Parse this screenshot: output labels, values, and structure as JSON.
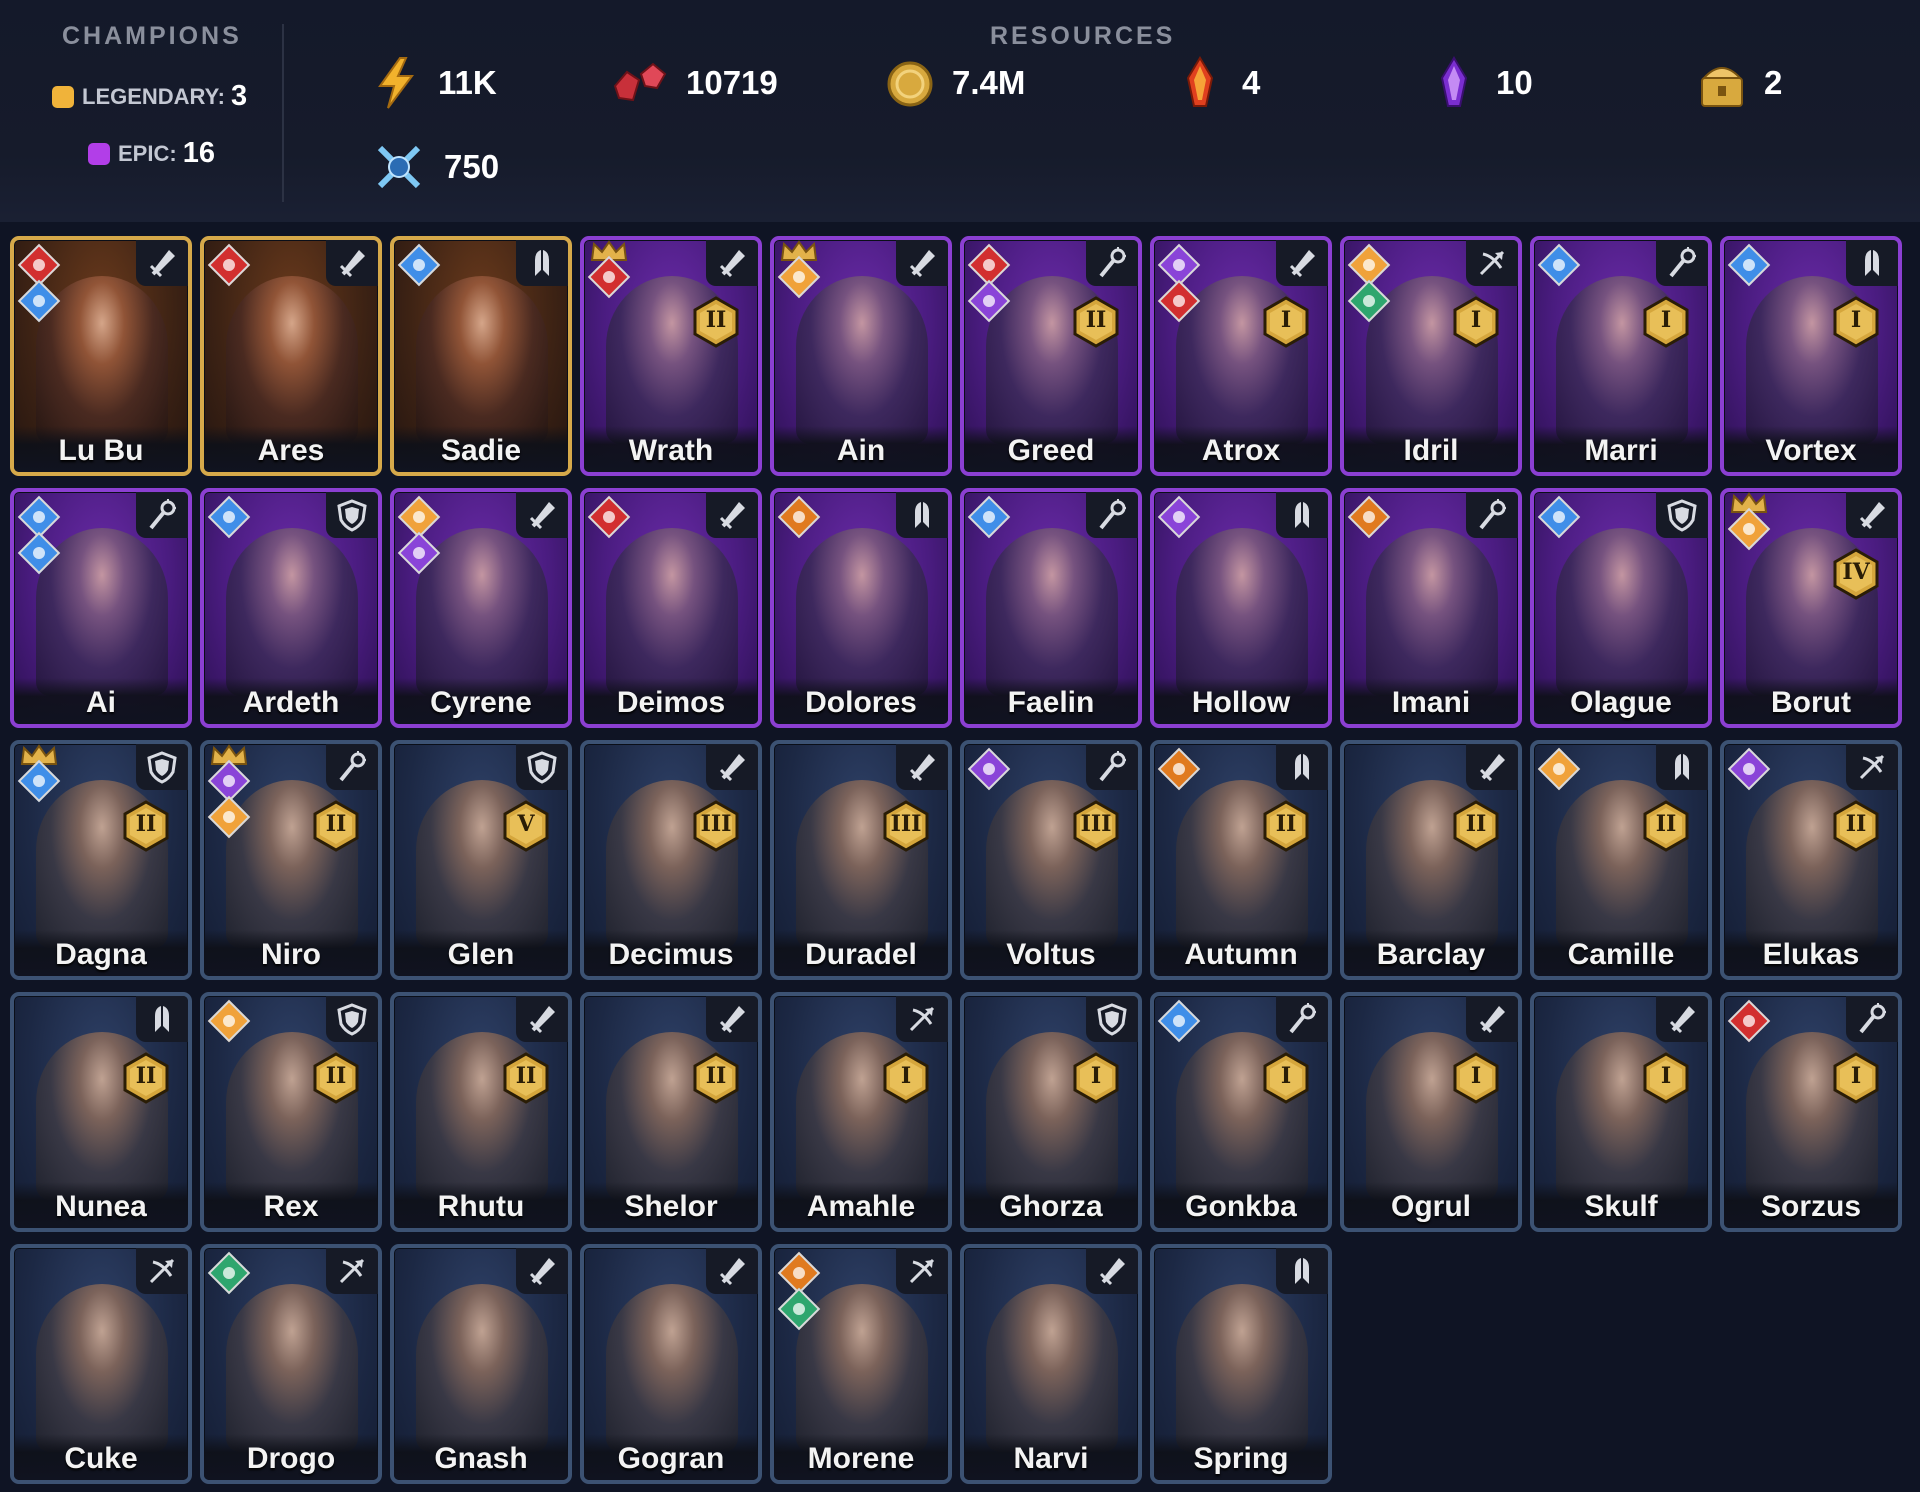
{
  "header": {
    "champions_title": "CHAMPIONS",
    "resources_title": "RESOURCES",
    "legendary": {
      "label": "LEGENDARY:",
      "count": "3",
      "color": "#f0b33a"
    },
    "epic": {
      "label": "EPIC:",
      "count": "16",
      "color": "#b23ee8"
    },
    "resources": [
      {
        "icon": "energy-icon",
        "value": "11K"
      },
      {
        "icon": "rubies-icon",
        "value": "10719"
      },
      {
        "icon": "gold-coin-icon",
        "value": "7.4M"
      },
      {
        "icon": "fire-shard-icon",
        "value": "4"
      },
      {
        "icon": "void-shard-icon",
        "value": "10"
      },
      {
        "icon": "chest-icon",
        "value": "2"
      },
      {
        "icon": "arena-token-icon",
        "value": "750"
      }
    ]
  },
  "colors": {
    "legendary_border": "#d6a94a",
    "epic_border": "#8b3fd2",
    "rare_border": "#3c5273",
    "affinity_order": "#3f8ee8",
    "affinity_chaos": "#d22f2f",
    "affinity_spirit": "#8a44d8",
    "affinity_fire": "#e07a1f",
    "affinity_orb": "#f0a23a",
    "affinity_nature": "#2ea66e"
  },
  "champions": [
    {
      "name": "Lu Bu",
      "rarity": "legendary",
      "role": "sword",
      "affinities": [
        "chaos",
        "order"
      ]
    },
    {
      "name": "Ares",
      "rarity": "legendary",
      "role": "sword",
      "affinities": [
        "chaos"
      ]
    },
    {
      "name": "Sadie",
      "rarity": "legendary",
      "role": "support",
      "affinities": [
        "order"
      ]
    },
    {
      "name": "Wrath",
      "rarity": "epic",
      "role": "sword",
      "affinities": [
        "chaos"
      ],
      "crown": true,
      "rank": "II"
    },
    {
      "name": "Ain",
      "rarity": "epic",
      "role": "sword",
      "affinities": [
        "orb"
      ],
      "crown": true
    },
    {
      "name": "Greed",
      "rarity": "epic",
      "role": "mage",
      "affinities": [
        "chaos",
        "spirit"
      ],
      "rank": "II"
    },
    {
      "name": "Atrox",
      "rarity": "epic",
      "role": "sword",
      "affinities": [
        "spirit",
        "chaos"
      ],
      "rank": "I"
    },
    {
      "name": "Idril",
      "rarity": "epic",
      "role": "ranged",
      "affinities": [
        "orb",
        "nature"
      ],
      "rank": "I"
    },
    {
      "name": "Marri",
      "rarity": "epic",
      "role": "mage",
      "affinities": [
        "order"
      ],
      "rank": "I"
    },
    {
      "name": "Vortex",
      "rarity": "epic",
      "role": "support",
      "affinities": [
        "order"
      ],
      "rank": "I"
    },
    {
      "name": "Ai",
      "rarity": "epic",
      "role": "mage",
      "affinities": [
        "order",
        "order"
      ]
    },
    {
      "name": "Ardeth",
      "rarity": "epic",
      "role": "shield",
      "affinities": [
        "order"
      ]
    },
    {
      "name": "Cyrene",
      "rarity": "epic",
      "role": "sword",
      "affinities": [
        "orb",
        "spirit"
      ]
    },
    {
      "name": "Deimos",
      "rarity": "epic",
      "role": "sword",
      "affinities": [
        "chaos"
      ]
    },
    {
      "name": "Dolores",
      "rarity": "epic",
      "role": "support",
      "affinities": [
        "fire"
      ]
    },
    {
      "name": "Faelin",
      "rarity": "epic",
      "role": "mage",
      "affinities": [
        "order"
      ]
    },
    {
      "name": "Hollow",
      "rarity": "epic",
      "role": "support",
      "affinities": [
        "spirit"
      ]
    },
    {
      "name": "Imani",
      "rarity": "epic",
      "role": "mage",
      "affinities": [
        "fire"
      ]
    },
    {
      "name": "Olague",
      "rarity": "epic",
      "role": "shield",
      "affinities": [
        "order"
      ]
    },
    {
      "name": "Borut",
      "rarity": "epic",
      "role": "sword",
      "affinities": [
        "orb"
      ],
      "crown": true,
      "rank": "IV"
    },
    {
      "name": "Dagna",
      "rarity": "rare",
      "role": "shield",
      "affinities": [
        "order"
      ],
      "crown": true,
      "rank": "II"
    },
    {
      "name": "Niro",
      "rarity": "rare",
      "role": "mage",
      "affinities": [
        "spirit",
        "orb"
      ],
      "crown": true,
      "rank": "II"
    },
    {
      "name": "Glen",
      "rarity": "rare",
      "role": "shield",
      "affinities": [],
      "rank": "V"
    },
    {
      "name": "Decimus",
      "rarity": "rare",
      "role": "sword",
      "affinities": [],
      "rank": "III"
    },
    {
      "name": "Duradel",
      "rarity": "rare",
      "role": "sword",
      "affinities": [],
      "rank": "III"
    },
    {
      "name": "Voltus",
      "rarity": "rare",
      "role": "mage",
      "affinities": [
        "spirit"
      ],
      "rank": "III"
    },
    {
      "name": "Autumn",
      "rarity": "rare",
      "role": "support",
      "affinities": [
        "fire"
      ],
      "rank": "II"
    },
    {
      "name": "Barclay",
      "rarity": "rare",
      "role": "sword",
      "affinities": [],
      "rank": "II"
    },
    {
      "name": "Camille",
      "rarity": "rare",
      "role": "support",
      "affinities": [
        "orb"
      ],
      "rank": "II"
    },
    {
      "name": "Elukas",
      "rarity": "rare",
      "role": "ranged",
      "affinities": [
        "spirit"
      ],
      "rank": "II"
    },
    {
      "name": "Nunea",
      "rarity": "rare",
      "role": "support",
      "affinities": [],
      "rank": "II"
    },
    {
      "name": "Rex",
      "rarity": "rare",
      "role": "shield",
      "affinities": [
        "orb"
      ],
      "rank": "II"
    },
    {
      "name": "Rhutu",
      "rarity": "rare",
      "role": "sword",
      "affinities": [],
      "rank": "II"
    },
    {
      "name": "Shelor",
      "rarity": "rare",
      "role": "sword",
      "affinities": [],
      "rank": "II"
    },
    {
      "name": "Amahle",
      "rarity": "rare",
      "role": "ranged",
      "affinities": [],
      "rank": "I"
    },
    {
      "name": "Ghorza",
      "rarity": "rare",
      "role": "shield",
      "affinities": [],
      "rank": "I"
    },
    {
      "name": "Gonkba",
      "rarity": "rare",
      "role": "mage",
      "affinities": [
        "order"
      ],
      "rank": "I"
    },
    {
      "name": "Ogrul",
      "rarity": "rare",
      "role": "sword",
      "affinities": [],
      "rank": "I"
    },
    {
      "name": "Skulf",
      "rarity": "rare",
      "role": "sword",
      "affinities": [],
      "rank": "I"
    },
    {
      "name": "Sorzus",
      "rarity": "rare",
      "role": "mage",
      "affinities": [
        "chaos"
      ],
      "rank": "I"
    },
    {
      "name": "Cuke",
      "rarity": "rare",
      "role": "ranged",
      "affinities": []
    },
    {
      "name": "Drogo",
      "rarity": "rare",
      "role": "ranged",
      "affinities": [
        "nature"
      ]
    },
    {
      "name": "Gnash",
      "rarity": "rare",
      "role": "sword",
      "affinities": []
    },
    {
      "name": "Gogran",
      "rarity": "rare",
      "role": "sword",
      "affinities": []
    },
    {
      "name": "Morene",
      "rarity": "rare",
      "role": "ranged",
      "affinities": [
        "fire",
        "nature"
      ]
    },
    {
      "name": "Narvi",
      "rarity": "rare",
      "role": "sword",
      "affinities": []
    },
    {
      "name": "Spring",
      "rarity": "rare",
      "role": "support",
      "affinities": []
    }
  ]
}
